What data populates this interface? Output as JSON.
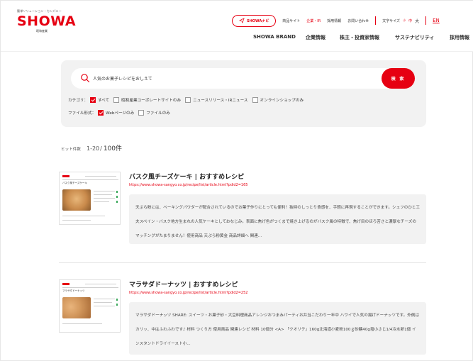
{
  "header": {
    "logo": {
      "tagline": "簡単ソリューション・カンパニー",
      "word": "SHOWA",
      "sub": "昭和産業"
    },
    "navi_button": "SHOWAナビ",
    "top_links": [
      "商品サイト",
      "企業・IR",
      "採用情報",
      "お問い合わせ"
    ],
    "font_size_label": "文字サイズ",
    "font_sizes": [
      "小",
      "中",
      "大"
    ],
    "lang": "EN",
    "main_nav": [
      "SHOWA BRAND",
      "企業情報",
      "株主・投資家情報",
      "サステナビリティ",
      "採用情報"
    ]
  },
  "search": {
    "query": "人気のお菓子レシピをおしえて",
    "button": "検 索",
    "category_label": "カテゴリ：",
    "categories": [
      {
        "label": "すべて",
        "checked": true
      },
      {
        "label": "昭和産業コーポレートサイトのみ",
        "checked": false
      },
      {
        "label": "ニュースリリース・IRニュース",
        "checked": false
      },
      {
        "label": "オンラインショップのみ",
        "checked": false
      }
    ],
    "filetype_label": "ファイル形式：",
    "filetypes": [
      {
        "label": "Webページのみ",
        "checked": true
      },
      {
        "label": "ファイルのみ",
        "checked": false
      }
    ]
  },
  "hits": {
    "label": "ヒット件数",
    "range": "1-20",
    "separator": "/",
    "total": "100件"
  },
  "results": [
    {
      "title": "バスク風チーズケーキ | おすすめレシピ",
      "url": "https://www.showa-sangyo.co.jp/recipe/list/article.html?pdid2=165",
      "snippet": "天ぷら粉には、ベーキングパウダーが配合されているのでお菓子作りにとっても便利！独特のしっとり食感を、手軽に再現することができます。シェフのひと工夫スペイン・バスク地方生まれの人気ケーキとしておなじみ。表面に焦げ色がつくまで焼き上げるのがバスク風の特徴で、焦げ目のほろ苦さと濃厚なチーズのマッチングがたまりません！使用商品 天ぷら粉黄金 商品詳細へ 関連...",
      "thumb_title": "バスク風チーズケーキ",
      "photo_color": "#c98a4b"
    },
    {
      "title": "マラサダドーナッツ | おすすめレシピ",
      "url": "https://www.showa-sangyo.co.jp/recipe/list/article.html?pdid2=252",
      "snippet": "マラサダドーナッツ SHARE: スイーツ・お菓子砂・大豆料理商品アレンジおつまみパーティお弁当こだわり一年中 ハワイで人気の揚げドーナッツです。外側はカリッ、中はふわふわです♪ 材料 つくり方 使用商品 関連レシピ 材料 10個分 <A> 「クオリテ」160g北海道小麦粉100ｇ砂糖40g塩小さじ1/4冷水卵1個 インスタントドライイースト小...",
      "thumb_title": "マラサダドーナッツ",
      "photo_color": "#d4995e"
    }
  ],
  "colors": {
    "brand_red": "#e60012",
    "panel_gray": "#f2f2f2"
  }
}
